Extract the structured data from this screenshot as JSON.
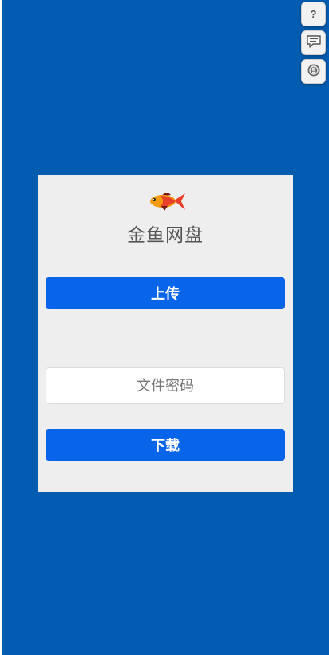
{
  "app": {
    "title": "金鱼网盘",
    "logo_icon": "goldfish-icon"
  },
  "actions": {
    "upload_label": "上传",
    "download_label": "下载"
  },
  "password_field": {
    "placeholder": "文件密码",
    "value": ""
  },
  "side_tools": [
    {
      "name": "help-icon",
      "label": "?"
    },
    {
      "name": "feedback-icon",
      "label": ""
    },
    {
      "name": "settings-icon",
      "label": ""
    }
  ],
  "colors": {
    "background": "#045cb0",
    "card": "#efeeee",
    "primary_button": "#0864e8"
  }
}
